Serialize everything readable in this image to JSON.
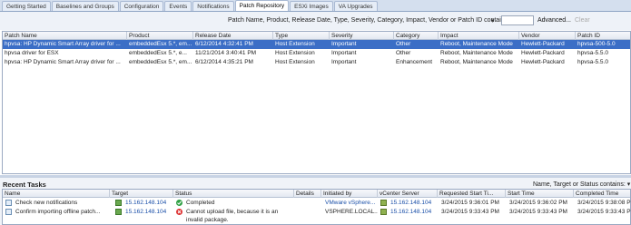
{
  "tabs": [
    "Getting Started",
    "Baselines and Groups",
    "Configuration",
    "Events",
    "Notifications",
    "Patch Repository",
    "ESXi Images",
    "VA Upgrades"
  ],
  "active_tab": "Patch Repository",
  "filter": {
    "label": "Patch Name, Product, Release Date, Type, Severity, Category, Impact, Vendor or Patch ID contains:",
    "dropdown_glyph": "▾",
    "advanced": "Advanced...",
    "clear": "Clear"
  },
  "patch_table": {
    "columns": [
      "Patch Name",
      "Product",
      "Release Date",
      "Type",
      "Severity",
      "Category",
      "Impact",
      "Vendor",
      "Patch ID"
    ],
    "rows": [
      [
        "hpvsa: HP Dynamic Smart Array driver for ...",
        "embeddedEsx 5.*, em...",
        "6/12/2014 4:32:41 PM",
        "Host Extension",
        "Important",
        "Other",
        "Reboot, Maintenance Mode",
        "Hewlett-Packard",
        "hpvsa-500-5.0"
      ],
      [
        "hpvsa driver for ESX",
        "embeddedEsx 5.*, e...",
        "11/21/2014 3:40:41 PM",
        "Host Extension",
        "Important",
        "Other",
        "Reboot, Maintenance Mode",
        "Hewlett-Packard",
        "hpvsa-5.5.0"
      ],
      [
        "hpvsa: HP Dynamic Smart Array driver for ...",
        "embeddedEsx 5.*, em...",
        "6/12/2014 4:35:21 PM",
        "Host Extension",
        "Important",
        "Enhancement",
        "Reboot, Maintenance Mode",
        "Hewlett-Packard",
        "hpvsa-5.5.0"
      ]
    ]
  },
  "recent_tasks": {
    "title": "Recent Tasks",
    "filter_label": "Name, Target or Status contains: ▾",
    "columns": [
      "Name",
      "Target",
      "Status",
      "Details",
      "Initiated by",
      "vCenter Server",
      "Requested Start Ti...",
      "Start Time",
      "Completed Time"
    ],
    "rows": [
      {
        "name": "Check new notifications",
        "target": "15.162.148.104",
        "status": "Completed",
        "status_icon": "check-icon",
        "details": "",
        "initiated_by": "VMware vSphere...",
        "vcenter": "15.162.148.104",
        "requested": "3/24/2015 9:36:01 PM",
        "start": "3/24/2015 9:36:02 PM",
        "completed": "3/24/2015 9:38:08 P"
      },
      {
        "name": "Confirm importing offline patch...",
        "target": "15.162.148.104",
        "status": "Cannot upload file, because it is an",
        "status2": "invalid package.",
        "status_icon": "error-icon",
        "details": "",
        "initiated_by": "VSPHERE.LOCAL...",
        "vcenter": "15.162.148.104",
        "requested": "3/24/2015 9:33:43 PM",
        "start": "3/24/2015 9:33:43 PM",
        "completed": "3/24/2015 9:33:43 P"
      }
    ]
  },
  "colors": {
    "selected_row": "#3b6ec6",
    "link": "#1a4fa8",
    "tab_bar": "#d4dfee"
  }
}
